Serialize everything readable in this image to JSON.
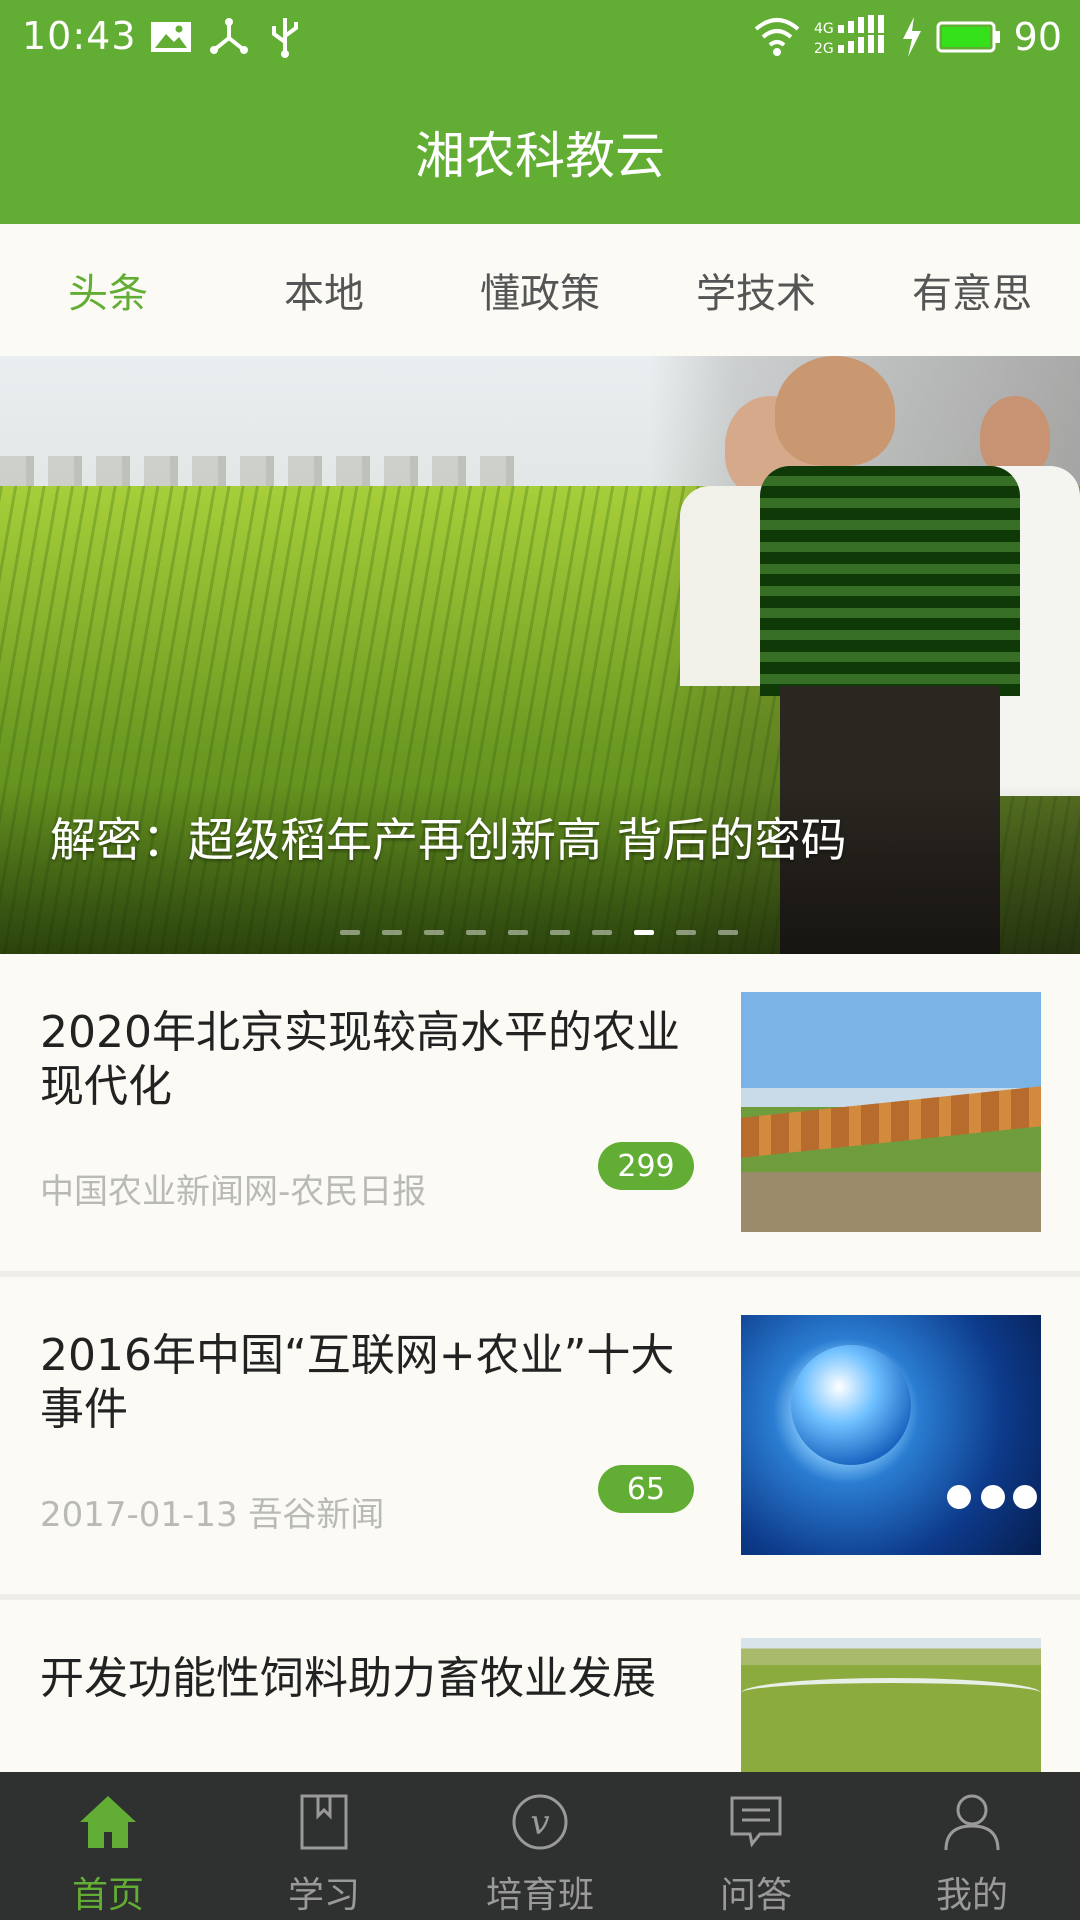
{
  "status_bar": {
    "time": "10:43",
    "network_label": "4G\n2G",
    "battery": "90",
    "accent_color": "#62ad33",
    "icons": [
      "image-icon",
      "share-icon",
      "usb-icon",
      "wifi-icon",
      "signal-icon",
      "charging-icon",
      "battery-icon"
    ]
  },
  "app": {
    "title": "湘农科教云"
  },
  "tabs": [
    {
      "label": "头条",
      "active": true
    },
    {
      "label": "本地",
      "active": false
    },
    {
      "label": "懂政策",
      "active": false
    },
    {
      "label": "学技术",
      "active": false
    },
    {
      "label": "有意思",
      "active": false
    }
  ],
  "banner": {
    "caption": "解密：超级稻年产再创新高 背后的密码",
    "dots_total": 10,
    "active_dot": 8
  },
  "news": [
    {
      "title": "2020年北京实现较高水平的农业现代化",
      "source": "中国农业新闻网-农民日报",
      "count": "299"
    },
    {
      "title": "2016年中国“互联网+农业”十大事件",
      "source": "2017-01-13  吾谷新闻",
      "count": "65"
    },
    {
      "title": "开发功能性饲料助力畜牧业发展",
      "source": "",
      "count": ""
    }
  ],
  "bottom_nav": [
    {
      "label": "首页",
      "icon": "home-icon",
      "active": true
    },
    {
      "label": "学习",
      "icon": "book-icon",
      "active": false
    },
    {
      "label": "培育班",
      "icon": "v-circle-icon",
      "active": false
    },
    {
      "label": "问答",
      "icon": "chat-icon",
      "active": false
    },
    {
      "label": "我的",
      "icon": "user-icon",
      "active": false
    }
  ]
}
